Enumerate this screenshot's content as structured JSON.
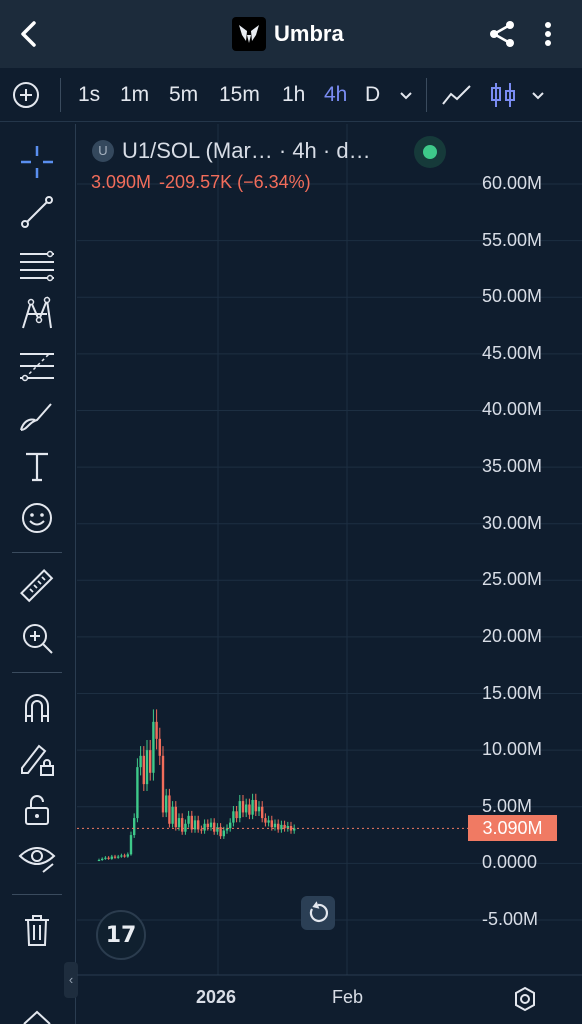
{
  "appbar": {
    "title": "Umbra",
    "icons": {
      "back": "chevron-left-icon",
      "share": "share-icon",
      "more": "more-vert-icon"
    }
  },
  "timeframes": {
    "items": [
      "1s",
      "1m",
      "5m",
      "15m",
      "1h",
      "4h",
      "D"
    ],
    "active": "4h",
    "icons": {
      "add": "plus-circle-icon",
      "dropdown": "chevron-down-icon",
      "line_chart": "line-chart-icon",
      "candles": "candlestick-icon"
    }
  },
  "legend": {
    "badge": "U",
    "title": "U1/SOL (Mar… · 4h · d…",
    "price": "3.090M",
    "change": "-209.57K (−6.34%)",
    "status_color": "#3ec98a"
  },
  "colors": {
    "up": "#3ec98a",
    "down": "#f26d5b",
    "price_line": "#f07a63",
    "active_tf": "#7a8cf2"
  },
  "chart_data": {
    "type": "candlestick",
    "symbol": "U1/SOL",
    "interval": "4h",
    "last_price": 3.09,
    "last_price_label": "3.090M",
    "unit": "M",
    "ylim": [
      -5.0,
      60.0
    ],
    "y_ticks": [
      "60.00M",
      "55.00M",
      "50.00M",
      "45.00M",
      "40.00M",
      "35.00M",
      "30.00M",
      "25.00M",
      "20.00M",
      "15.00M",
      "10.00M",
      "5.00M",
      "0.0000",
      "-5.00M"
    ],
    "x_ticks": [
      "2026",
      "Feb"
    ],
    "series_close": [
      0.3,
      0.4,
      0.5,
      0.4,
      0.6,
      0.5,
      0.6,
      0.7,
      0.6,
      0.8,
      2.5,
      4.0,
      8.5,
      9.5,
      7.0,
      10.0,
      8.0,
      12.5,
      11.0,
      9.5,
      4.5,
      6.0,
      3.5,
      5.0,
      3.2,
      4.0,
      2.8,
      3.5,
      4.2,
      3.0,
      3.8,
      3.0,
      2.9,
      3.5,
      3.2,
      3.6,
      2.8,
      3.2,
      2.4,
      2.9,
      3.1,
      3.6,
      4.6,
      4.0,
      5.5,
      4.5,
      5.2,
      4.3,
      5.6,
      4.6,
      5.0,
      4.0,
      3.6,
      3.8,
      3.2,
      3.5,
      3.0,
      3.4,
      3.1,
      3.3,
      2.9,
      3.09
    ]
  },
  "left_tools": [
    "crosshair-icon",
    "trend-line-icon",
    "horizontal-lines-icon",
    "pattern-icon",
    "fib-icon",
    "brush-icon",
    "text-icon",
    "emoji-icon",
    "ruler-icon",
    "zoom-in-icon",
    "magnet-icon",
    "pencil-lock-icon",
    "unlock-icon",
    "eye-icon",
    "trash-icon"
  ],
  "controls": {
    "reset": "rotate-icon",
    "settings": "settings-icon",
    "tv_logo": "tradingview-logo-icon",
    "logo_text": "17"
  }
}
